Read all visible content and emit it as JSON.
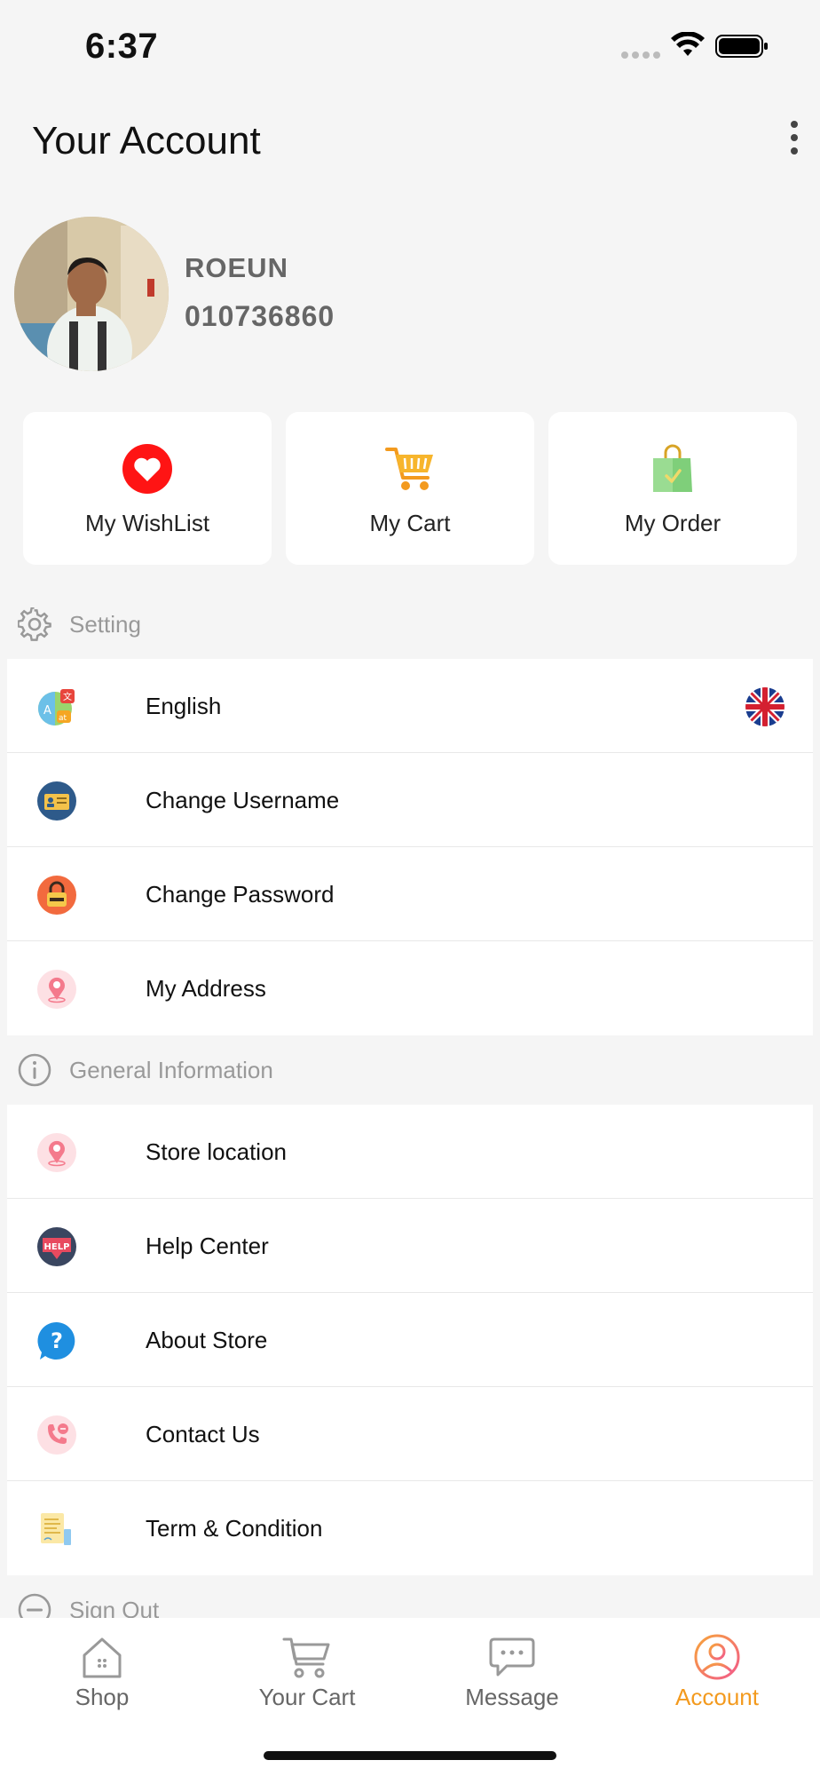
{
  "status_bar": {
    "time": "6:37"
  },
  "header": {
    "title": "Your Account"
  },
  "profile": {
    "name": "ROEUN",
    "phone": "010736860"
  },
  "quick_actions": [
    {
      "label": "My WishList",
      "icon": "heart-icon"
    },
    {
      "label": "My Cart",
      "icon": "cart-icon"
    },
    {
      "label": "My Order",
      "icon": "shopping-bag-icon"
    }
  ],
  "settings_section": {
    "title": "Setting",
    "icon": "gear-icon",
    "items": [
      {
        "label": "English",
        "icon": "translate-icon",
        "trailing": "uk-flag-icon"
      },
      {
        "label": "Change Username",
        "icon": "id-card-icon"
      },
      {
        "label": "Change Password",
        "icon": "lock-icon"
      },
      {
        "label": "My Address",
        "icon": "location-pin-icon"
      }
    ]
  },
  "general_section": {
    "title": "General Information",
    "icon": "info-icon",
    "items": [
      {
        "label": "Store location",
        "icon": "store-pin-icon"
      },
      {
        "label": "Help Center",
        "icon": "help-badge-icon"
      },
      {
        "label": "About Store",
        "icon": "question-bubble-icon"
      },
      {
        "label": "Contact Us",
        "icon": "phone-icon"
      },
      {
        "label": "Term & Condition",
        "icon": "document-icon"
      }
    ]
  },
  "sign_out": {
    "label": "Sign Out",
    "icon": "minus-circle-icon"
  },
  "bottom_nav": [
    {
      "label": "Shop",
      "icon": "home-icon"
    },
    {
      "label": "Your Cart",
      "icon": "cart-outline-icon"
    },
    {
      "label": "Message",
      "icon": "chat-icon"
    },
    {
      "label": "Account",
      "icon": "user-icon",
      "active": true
    }
  ],
  "colors": {
    "accent": "#f39a1e",
    "background": "#f5f5f5",
    "heart_red": "#ff1a1a"
  }
}
